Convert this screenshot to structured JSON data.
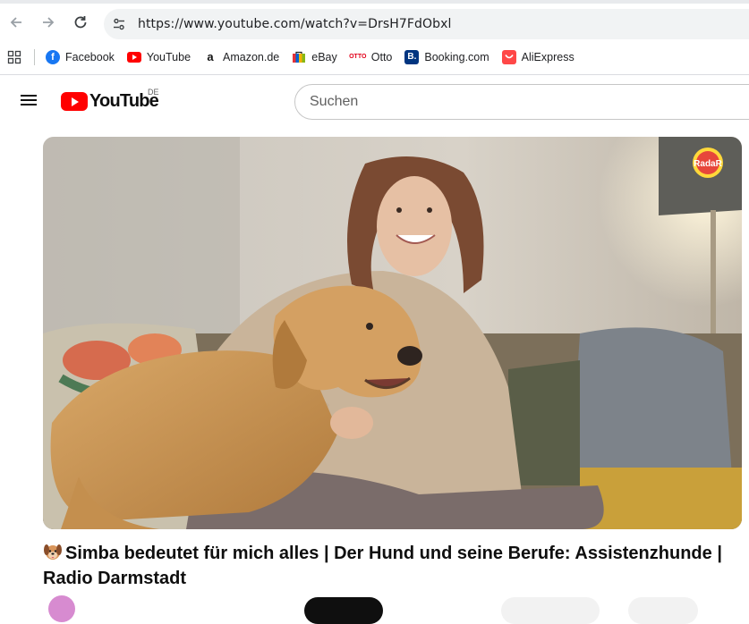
{
  "browser": {
    "url": "https://www.youtube.com/watch?v=DrsH7FdObxl",
    "bookmarks": [
      {
        "label": "Facebook",
        "icon": "facebook-icon",
        "color": "#1877f2"
      },
      {
        "label": "YouTube",
        "icon": "youtube-icon",
        "color": "#ff0000"
      },
      {
        "label": "Amazon.de",
        "icon": "amazon-icon",
        "color": "#232f3e"
      },
      {
        "label": "eBay",
        "icon": "ebay-icon",
        "color": "#e53238"
      },
      {
        "label": "Otto",
        "icon": "otto-icon",
        "color": "#e2001a"
      },
      {
        "label": "Booking.com",
        "icon": "booking-icon",
        "color": "#003580"
      },
      {
        "label": "AliExpress",
        "icon": "aliexpress-icon",
        "color": "#ff4747"
      }
    ]
  },
  "youtube": {
    "logo_text": "YouTube",
    "country_code": "DE",
    "search_placeholder": "Suchen"
  },
  "video": {
    "watermark": "RadaR",
    "title": "Simba bedeutet für mich alles | Der Hund und seine Berufe: Assistenzhunde | Radio Darmstadt",
    "title_icon": "dog-face-icon"
  }
}
